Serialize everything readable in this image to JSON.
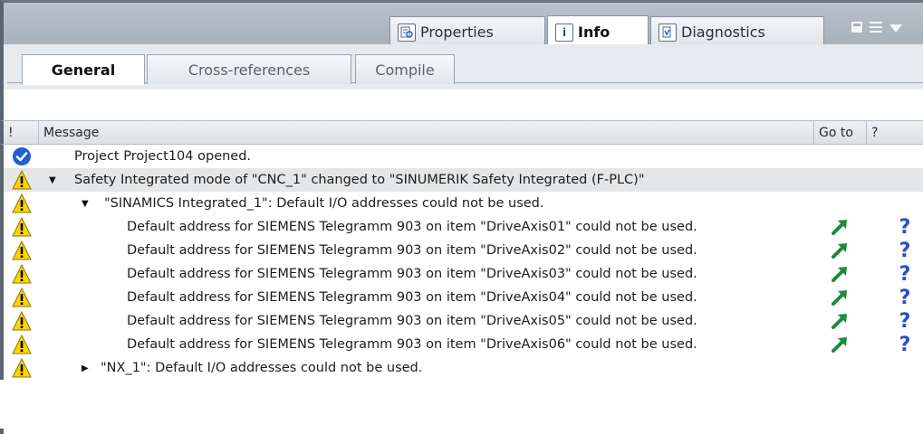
{
  "top_tabs": [
    {
      "label": "Properties",
      "icon": "properties-icon",
      "active": false
    },
    {
      "label": "Info",
      "icon": "info-icon",
      "active": true
    },
    {
      "label": "Diagnostics",
      "icon": "diagnostics-icon",
      "active": false
    }
  ],
  "sub_tabs": [
    {
      "label": "General",
      "active": true
    },
    {
      "label": "Cross-references",
      "active": false
    },
    {
      "label": "Compile",
      "active": false
    }
  ],
  "table": {
    "columns": {
      "status": "!",
      "message": "Message",
      "goto": "Go to",
      "help": "?"
    },
    "rows": [
      {
        "status": "info-check",
        "message": "Project Project104 opened.",
        "caret": "",
        "goto": false,
        "help": false
      },
      {
        "status": "warning",
        "message": "Safety Integrated mode of \"CNC_1\" changed to \"SINUMERIK Safety Integrated (F-PLC)\"",
        "caret": "expanded",
        "goto": false,
        "help": false
      },
      {
        "status": "warning",
        "message": "\"SINAMICS Integrated_1\": Default I/O addresses could not be used.",
        "caret": "expanded",
        "goto": false,
        "help": false
      },
      {
        "status": "warning",
        "message": "Default address for SIEMENS Telegramm 903 on item \"DriveAxis01\" could not be used.",
        "caret": "",
        "goto": true,
        "help": true
      },
      {
        "status": "warning",
        "message": "Default address for SIEMENS Telegramm 903 on item \"DriveAxis02\" could not be used.",
        "caret": "",
        "goto": true,
        "help": true
      },
      {
        "status": "warning",
        "message": "Default address for SIEMENS Telegramm 903 on item \"DriveAxis03\" could not be used.",
        "caret": "",
        "goto": true,
        "help": true
      },
      {
        "status": "warning",
        "message": "Default address for SIEMENS Telegramm 903 on item \"DriveAxis04\" could not be used.",
        "caret": "",
        "goto": true,
        "help": true
      },
      {
        "status": "warning",
        "message": "Default address for SIEMENS Telegramm 903 on item \"DriveAxis05\" could not be used.",
        "caret": "",
        "goto": true,
        "help": true
      },
      {
        "status": "warning",
        "message": "Default address for SIEMENS Telegramm 903 on item \"DriveAxis06\" could not be used.",
        "caret": "",
        "goto": true,
        "help": true
      },
      {
        "status": "warning",
        "message": "\"NX_1\": Default I/O addresses could not be used.",
        "caret": "collapsed",
        "goto": false,
        "help": false
      }
    ]
  },
  "colors": {
    "accent_blue": "#1f5fd6",
    "warning_yellow": "#ffd400",
    "goto_green": "#1e8a3a",
    "help_blue": "#2b4fc4"
  }
}
